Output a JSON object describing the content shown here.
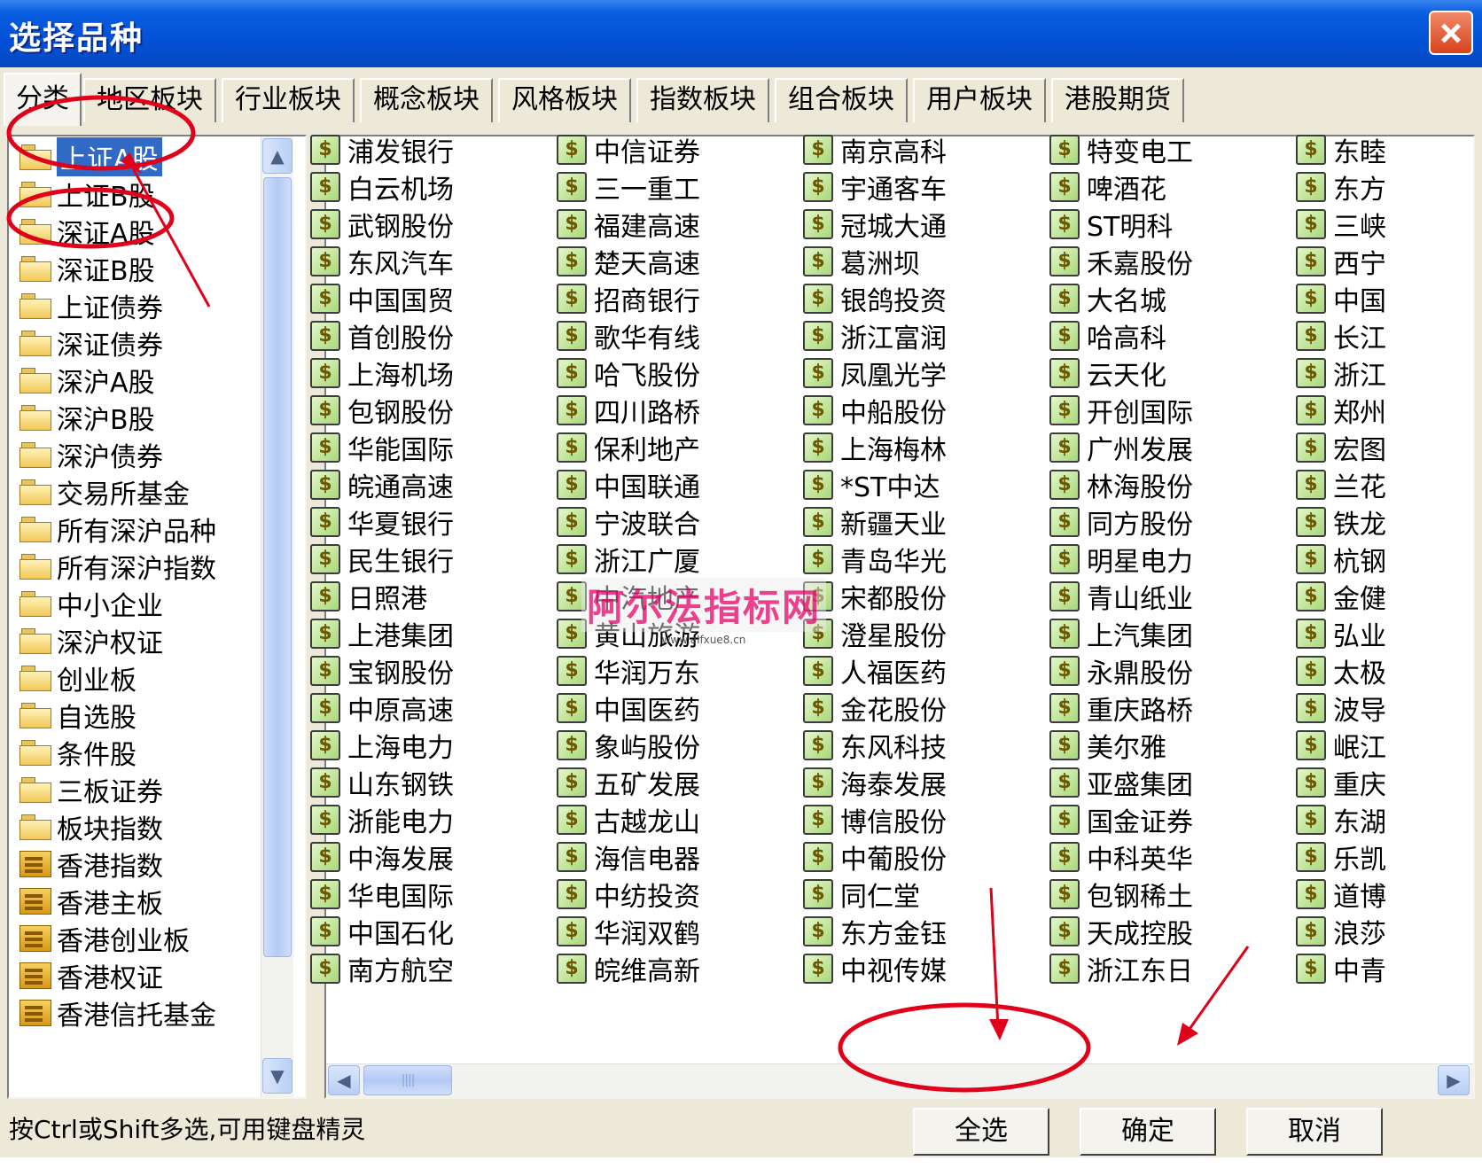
{
  "window": {
    "title": "选择品种"
  },
  "tabs": [
    {
      "label": "分类",
      "active": true
    },
    {
      "label": "地区板块"
    },
    {
      "label": "行业板块"
    },
    {
      "label": "概念板块"
    },
    {
      "label": "风格板块"
    },
    {
      "label": "指数板块"
    },
    {
      "label": "组合板块"
    },
    {
      "label": "用户板块"
    },
    {
      "label": "港股期货"
    }
  ],
  "categories": [
    {
      "label": "上证A股",
      "icon": "folder-icon",
      "selected": true
    },
    {
      "label": "上证B股",
      "icon": "folder-icon"
    },
    {
      "label": "深证A股",
      "icon": "folder-icon"
    },
    {
      "label": "深证B股",
      "icon": "folder-icon"
    },
    {
      "label": "上证债券",
      "icon": "folder-icon"
    },
    {
      "label": "深证债券",
      "icon": "folder-icon"
    },
    {
      "label": "深沪A股",
      "icon": "folder-icon"
    },
    {
      "label": "深沪B股",
      "icon": "folder-icon"
    },
    {
      "label": "深沪债券",
      "icon": "folder-icon"
    },
    {
      "label": "交易所基金",
      "icon": "folder-icon"
    },
    {
      "label": "所有深沪品种",
      "icon": "folder-icon"
    },
    {
      "label": "所有深沪指数",
      "icon": "folder-icon"
    },
    {
      "label": "中小企业",
      "icon": "folder-icon"
    },
    {
      "label": "深沪权证",
      "icon": "folder-icon"
    },
    {
      "label": "创业板",
      "icon": "folder-icon"
    },
    {
      "label": "自选股",
      "icon": "folder-icon"
    },
    {
      "label": "条件股",
      "icon": "folder-icon"
    },
    {
      "label": "三板证券",
      "icon": "folder-icon"
    },
    {
      "label": "板块指数",
      "icon": "folder-icon"
    },
    {
      "label": "香港指数",
      "icon": "hk-board-icon"
    },
    {
      "label": "香港主板",
      "icon": "hk-board-icon"
    },
    {
      "label": "香港创业板",
      "icon": "hk-board-icon"
    },
    {
      "label": "香港权证",
      "icon": "hk-board-icon"
    },
    {
      "label": "香港信托基金",
      "icon": "hk-board-icon"
    }
  ],
  "stock_icon_glyph": "$",
  "stocks": [
    [
      "浦发银行",
      "白云机场",
      "武钢股份",
      "东风汽车",
      "中国国贸",
      "首创股份",
      "上海机场",
      "包钢股份",
      "华能国际",
      "皖通高速",
      "华夏银行",
      "民生银行",
      "日照港",
      "上港集团",
      "宝钢股份",
      "中原高速",
      "上海电力",
      "山东钢铁",
      "浙能电力",
      "中海发展",
      "华电国际",
      "中国石化",
      "南方航空"
    ],
    [
      "中信证券",
      "三一重工",
      "福建高速",
      "楚天高速",
      "招商银行",
      "歌华有线",
      "哈飞股份",
      "四川路桥",
      "保利地产",
      "中国联通",
      "宁波联合",
      "浙江广厦",
      "中汽地产",
      "黄山旅游",
      "华润万东",
      "中国医药",
      "象屿股份",
      "五矿发展",
      "古越龙山",
      "海信电器",
      "中纺投资",
      "华润双鹤",
      "皖维高新"
    ],
    [
      "南京高科",
      "宇通客车",
      "冠城大通",
      "葛洲坝",
      "银鸽投资",
      "浙江富润",
      "凤凰光学",
      "中船股份",
      "上海梅林",
      "*ST中达",
      "新疆天业",
      "青岛华光",
      "宋都股份",
      "澄星股份",
      "人福医药",
      "金花股份",
      "东风科技",
      "海泰发展",
      "博信股份",
      "中葡股份",
      "同仁堂",
      "东方金钰",
      "中视传媒"
    ],
    [
      "特变电工",
      "啤酒花",
      "ST明科",
      "禾嘉股份",
      "大名城",
      "哈高科",
      "云天化",
      "开创国际",
      "广州发展",
      "林海股份",
      "同方股份",
      "明星电力",
      "青山纸业",
      "上汽集团",
      "永鼎股份",
      "重庆路桥",
      "美尔雅",
      "亚盛集团",
      "国金证券",
      "中科英华",
      "包钢稀土",
      "天成控股",
      "浙江东日"
    ],
    [
      "东睦",
      "东方",
      "三峡",
      "西宁",
      "中国",
      "长江",
      "浙江",
      "郑州",
      "宏图",
      "兰花",
      "铁龙",
      "杭钢",
      "金健",
      "弘业",
      "太极",
      "波导",
      "岷江",
      "重庆",
      "东湖",
      "乐凯",
      "道博",
      "浪莎",
      "中青"
    ]
  ],
  "status": {
    "hint": "按Ctrl或Shift多选,可用键盘精灵"
  },
  "buttons": {
    "select_all": "全选",
    "ok": "确定",
    "cancel": "取消"
  },
  "watermark": {
    "main": "阿尔法指标网",
    "sub": "www.alfxue8.cn"
  },
  "colors": {
    "titlebar": "#0351d6",
    "selection": "#316ac5",
    "annotation": "#e0001a",
    "dialog_bg": "#ece9d8"
  }
}
